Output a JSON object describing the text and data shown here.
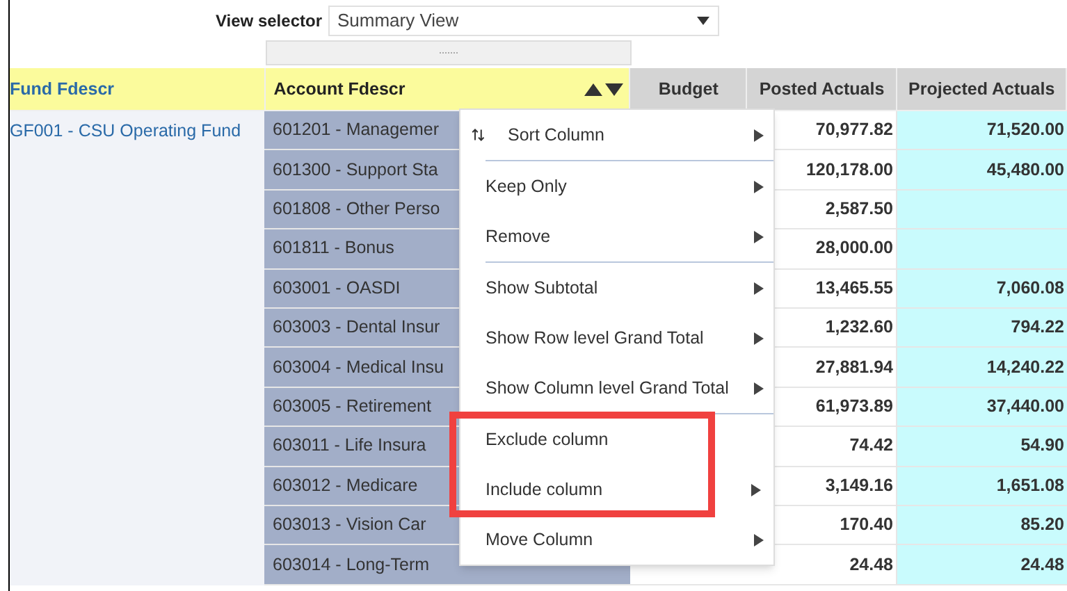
{
  "view_selector": {
    "label": "View selector",
    "value": "Summary View"
  },
  "table": {
    "columns": [
      {
        "label": "Fund Fdescr",
        "kind": "group",
        "sort_arrows": false
      },
      {
        "label": "Account Fdescr",
        "kind": "selected_dimension",
        "sort_arrows": true
      },
      {
        "label": "Budget",
        "kind": "measure",
        "sort_arrows": false
      },
      {
        "label": "Posted Actuals",
        "kind": "measure",
        "sort_arrows": false
      },
      {
        "label": "Projected Actuals",
        "kind": "projected_measure",
        "sort_arrows": false
      }
    ],
    "fund": "GF001 - CSU Operating Fund",
    "rows": [
      {
        "account": "601201 - Managemer",
        "posted": "70,977.82",
        "projected": "71,520.00"
      },
      {
        "account": "601300 - Support Sta",
        "posted": "120,178.00",
        "projected": "45,480.00"
      },
      {
        "account": "601808 - Other Perso",
        "posted": "2,587.50"
      },
      {
        "account": "601811 - Bonus",
        "posted": "28,000.00"
      },
      {
        "account": "603001 - OASDI",
        "posted": "13,465.55",
        "projected": "7,060.08"
      },
      {
        "account": "603003 - Dental Insur",
        "posted": "1,232.60",
        "projected": "794.22"
      },
      {
        "account": "603004 - Medical Insu",
        "posted": "27,881.94",
        "projected": "14,240.22"
      },
      {
        "account": "603005 - Retirement",
        "posted": "61,973.89",
        "projected": "37,440.00"
      },
      {
        "account": "603011 - Life Insura",
        "posted": "74.42",
        "projected": "54.90"
      },
      {
        "account": "603012 - Medicare",
        "posted": "3,149.16",
        "projected": "1,651.08"
      },
      {
        "account": "603013 - Vision Car",
        "posted": "170.40",
        "projected": "85.20"
      },
      {
        "account": "603014 - Long-Term",
        "posted": "24.48",
        "projected": "24.48"
      }
    ]
  },
  "context_menu": {
    "items": [
      {
        "label": "Sort Column",
        "kind": "sort",
        "submenu": true,
        "divider_after": true,
        "annotated": false
      },
      {
        "label": "Keep Only",
        "submenu": true,
        "divider_after": false,
        "annotated": false
      },
      {
        "label": "Remove",
        "submenu": true,
        "divider_after": true,
        "annotated": false
      },
      {
        "label": "Show Subtotal",
        "submenu": true,
        "divider_after": false,
        "annotated": false
      },
      {
        "label": "Show Row level Grand Total",
        "submenu": true,
        "divider_after": false,
        "annotated": false
      },
      {
        "label": "Show Column level Grand Total",
        "submenu": true,
        "divider_after": true,
        "annotated": false
      },
      {
        "label": "Exclude column",
        "submenu": false,
        "divider_after": false,
        "annotated": true
      },
      {
        "label": "Include column",
        "submenu": true,
        "divider_after": false,
        "annotated": true
      },
      {
        "label": "Move Column",
        "submenu": true,
        "divider_after": false,
        "annotated": false
      }
    ]
  }
}
